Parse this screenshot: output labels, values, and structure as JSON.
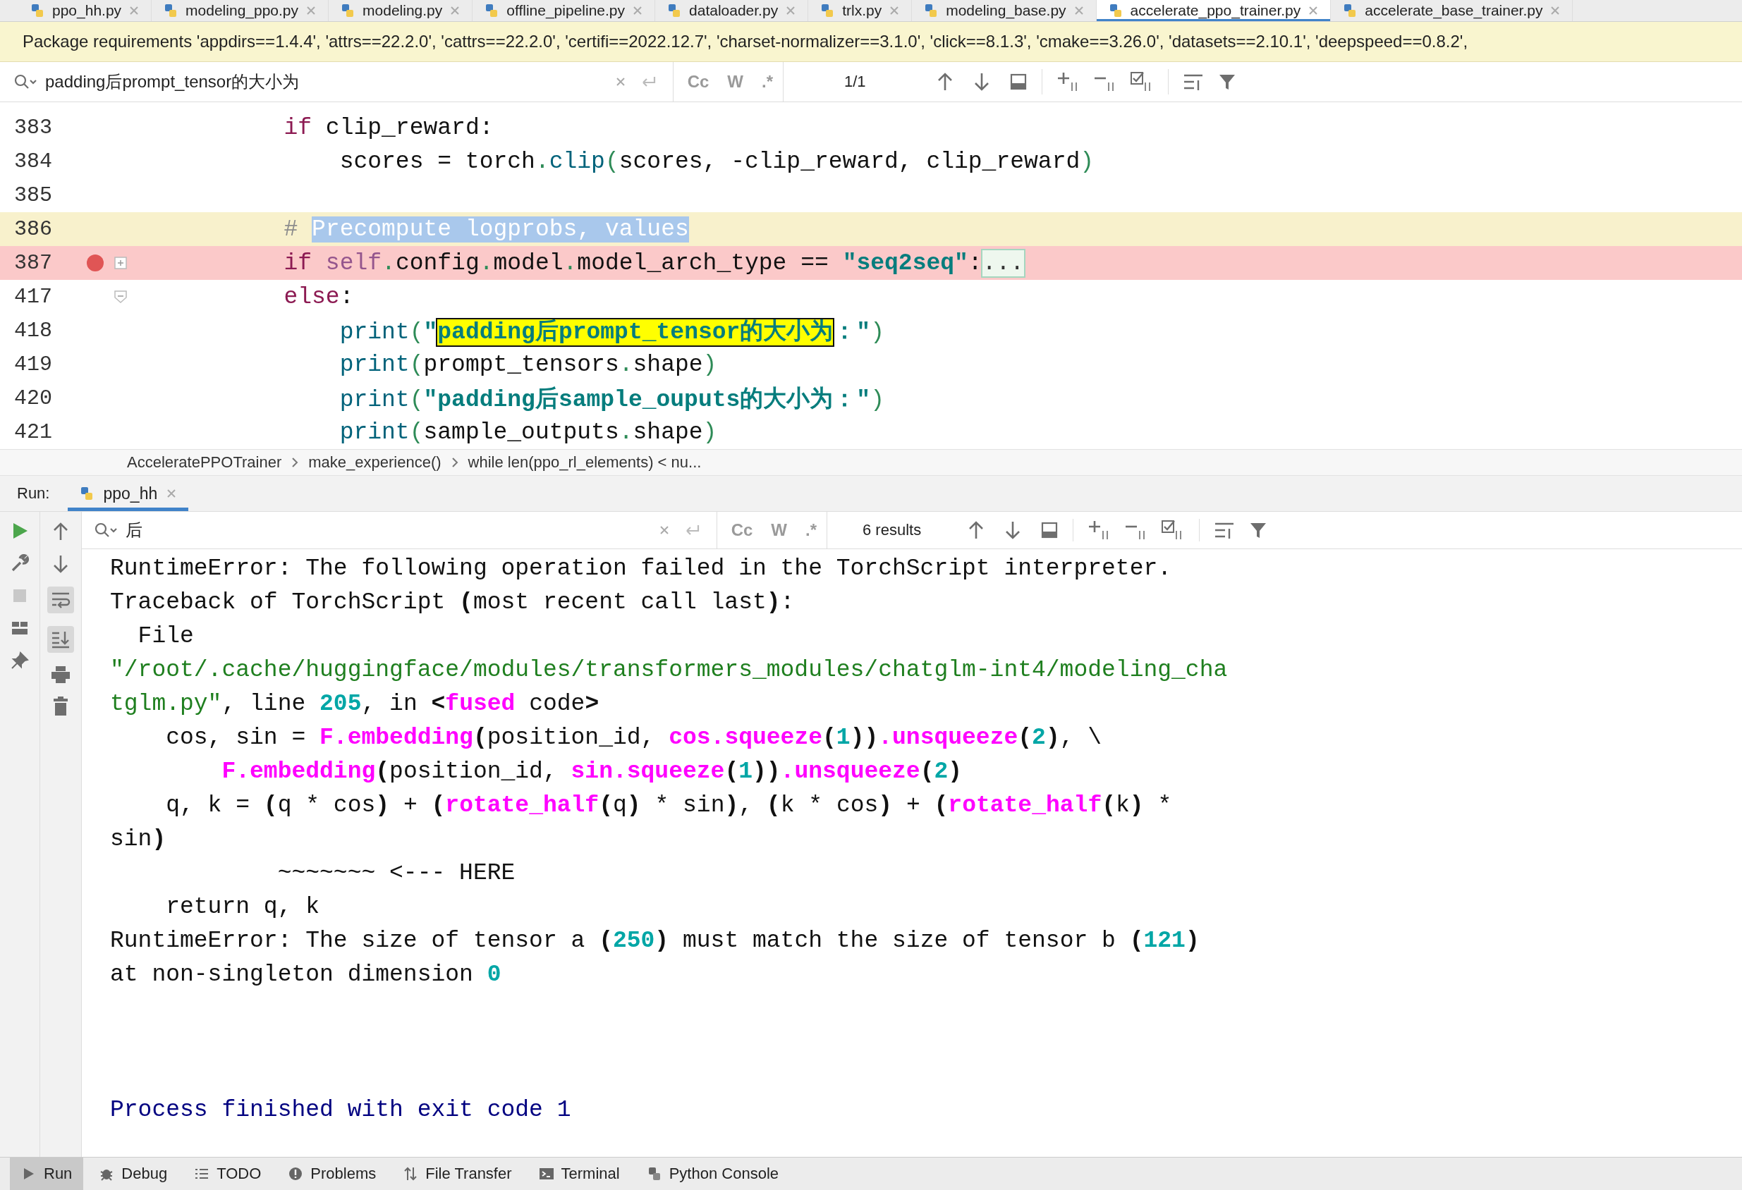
{
  "editor_tabs": [
    {
      "label": "ppo_hh.py",
      "selected": false
    },
    {
      "label": "modeling_ppo.py",
      "selected": false
    },
    {
      "label": "modeling.py",
      "selected": false
    },
    {
      "label": "offline_pipeline.py",
      "selected": false
    },
    {
      "label": "dataloader.py",
      "selected": false
    },
    {
      "label": "trlx.py",
      "selected": false
    },
    {
      "label": "modeling_base.py",
      "selected": false
    },
    {
      "label": "accelerate_ppo_trainer.py",
      "selected": true
    },
    {
      "label": "accelerate_base_trainer.py",
      "selected": false
    }
  ],
  "warning_bar": {
    "text": "Package requirements 'appdirs==1.4.4', 'attrs==22.2.0', 'cattrs==22.2.0', 'certifi==2022.12.7', 'charset-normalizer==3.1.0', 'click==8.1.3', 'cmake==3.26.0', 'datasets==2.10.1', 'deepspeed==0.8.2',"
  },
  "editor_find": {
    "value": "padding后prompt_tensor的大小为",
    "options": [
      "Cc",
      "W",
      ".*"
    ],
    "count": "1/1"
  },
  "code_lines": [
    {
      "number": "383",
      "kind": "plain",
      "breakpoint": false,
      "segments": [
        {
          "kind": "kw",
          "text": "        if"
        },
        {
          "kind": "plain",
          "text": " clip_reward:"
        }
      ]
    },
    {
      "number": "384",
      "kind": "plain",
      "breakpoint": false,
      "segments": [
        {
          "kind": "plain",
          "text": "            scores = torch"
        },
        {
          "kind": "dot",
          "text": "."
        },
        {
          "kind": "call",
          "text": "clip"
        },
        {
          "kind": "paren",
          "text": "("
        },
        {
          "kind": "plain",
          "text": "scores, -clip_reward, clip_reward"
        },
        {
          "kind": "paren",
          "text": ")"
        }
      ]
    },
    {
      "number": "385",
      "kind": "plain",
      "breakpoint": false
    },
    {
      "number": "386",
      "kind": "current",
      "breakpoint": false,
      "segments": [
        {
          "kind": "comment",
          "text": "        # "
        },
        {
          "kind": "selected",
          "text": "Precompute logprobs, values"
        }
      ]
    },
    {
      "number": "387",
      "kind": "breakpoint",
      "breakpoint": true,
      "expanded": false,
      "segments": [
        {
          "kind": "kw",
          "text": "        if "
        },
        {
          "kind": "self",
          "text": "self"
        },
        {
          "kind": "dot",
          "text": "."
        },
        {
          "kind": "plain",
          "text": "config"
        },
        {
          "kind": "dot",
          "text": "."
        },
        {
          "kind": "plain",
          "text": "model"
        },
        {
          "kind": "dot",
          "text": "."
        },
        {
          "kind": "plain",
          "text": "model_arch_type == "
        },
        {
          "kind": "str",
          "text": "\"seq2seq\""
        },
        {
          "kind": "plain",
          "text": ":"
        },
        {
          "kind": "folded",
          "text": "..."
        }
      ]
    },
    {
      "number": "417",
      "kind": "plain",
      "breakpoint": false,
      "expanded": true,
      "segments": [
        {
          "kind": "kw",
          "text": "        else"
        },
        {
          "kind": "plain",
          "text": ":"
        }
      ]
    },
    {
      "number": "418",
      "kind": "plain",
      "breakpoint": false,
      "segments": [
        {
          "kind": "call",
          "text": "            print"
        },
        {
          "kind": "paren",
          "text": "("
        },
        {
          "kind": "str",
          "text": "\""
        },
        {
          "kind": "match",
          "text": "padding后prompt_tensor的大小为"
        },
        {
          "kind": "str",
          "text": "：\""
        },
        {
          "kind": "paren",
          "text": ")"
        }
      ]
    },
    {
      "number": "419",
      "kind": "plain",
      "breakpoint": false,
      "segments": [
        {
          "kind": "call",
          "text": "            print"
        },
        {
          "kind": "paren",
          "text": "("
        },
        {
          "kind": "plain",
          "text": "prompt_tensors"
        },
        {
          "kind": "dot",
          "text": "."
        },
        {
          "kind": "plain",
          "text": "shape"
        },
        {
          "kind": "paren",
          "text": ")"
        }
      ]
    },
    {
      "number": "420",
      "kind": "plain",
      "breakpoint": false,
      "segments": [
        {
          "kind": "call",
          "text": "            print"
        },
        {
          "kind": "paren",
          "text": "("
        },
        {
          "kind": "str",
          "text": "\"padding后sample_ouputs的大小为：\""
        },
        {
          "kind": "paren",
          "text": ")"
        }
      ]
    },
    {
      "number": "421",
      "kind": "plain",
      "breakpoint": false,
      "segments": [
        {
          "kind": "call",
          "text": "            print"
        },
        {
          "kind": "paren",
          "text": "("
        },
        {
          "kind": "plain",
          "text": "sample_outputs"
        },
        {
          "kind": "dot",
          "text": "."
        },
        {
          "kind": "plain",
          "text": "shape"
        },
        {
          "kind": "paren",
          "text": ")"
        }
      ]
    }
  ],
  "breadcrumb": [
    "AcceleratePPOTrainer",
    "make_experience()",
    "while len(ppo_rl_elements) < nu..."
  ],
  "run_panel": {
    "label": "Run:",
    "tab": {
      "label": "ppo_hh",
      "selected": true
    }
  },
  "console_find": {
    "value": "后",
    "options": [
      "Cc",
      "W",
      ".*"
    ],
    "count": "6 results"
  },
  "console_lines": [
    {
      "kind": "output",
      "segments": [
        {
          "kind": "plain",
          "text": "RuntimeError: The following operation failed in the TorchScript interpreter."
        }
      ]
    },
    {
      "kind": "output",
      "segments": [
        {
          "kind": "plain",
          "text": "Traceback of TorchScript "
        },
        {
          "kind": "bold",
          "text": "("
        },
        {
          "kind": "plain",
          "text": "most recent call last"
        },
        {
          "kind": "bold",
          "text": ")"
        },
        {
          "kind": "plain",
          "text": ":"
        }
      ]
    },
    {
      "kind": "output",
      "segments": [
        {
          "kind": "plain",
          "text": "  File"
        }
      ]
    },
    {
      "kind": "output",
      "segments": [
        {
          "kind": "path",
          "text": "\"/root/.cache/huggingface/modules/transformers_modules/chatglm-int4/modeling_cha"
        }
      ]
    },
    {
      "kind": "output",
      "segments": [
        {
          "kind": "path",
          "text": "tglm.py\""
        },
        {
          "kind": "plain",
          "text": ", line "
        },
        {
          "kind": "num",
          "text": "205"
        },
        {
          "kind": "plain",
          "text": ", in "
        },
        {
          "kind": "bold",
          "text": "<"
        },
        {
          "kind": "mag",
          "text": "fused"
        },
        {
          "kind": "plain",
          "text": " code"
        },
        {
          "kind": "bold",
          "text": ">"
        }
      ]
    },
    {
      "kind": "output",
      "segments": [
        {
          "kind": "plain",
          "text": "    cos, sin = "
        },
        {
          "kind": "mag",
          "text": "F.embedding"
        },
        {
          "kind": "bold",
          "text": "("
        },
        {
          "kind": "plain",
          "text": "position_id, "
        },
        {
          "kind": "mag",
          "text": "cos.squeeze"
        },
        {
          "kind": "bold",
          "text": "("
        },
        {
          "kind": "num",
          "text": "1"
        },
        {
          "kind": "bold",
          "text": "))"
        },
        {
          "kind": "mag",
          "text": ".unsqueeze"
        },
        {
          "kind": "bold",
          "text": "("
        },
        {
          "kind": "num",
          "text": "2"
        },
        {
          "kind": "bold",
          "text": ")"
        },
        {
          "kind": "plain",
          "text": ", \\"
        }
      ]
    },
    {
      "kind": "output",
      "segments": [
        {
          "kind": "mag",
          "text": "        F.embedding"
        },
        {
          "kind": "bold",
          "text": "("
        },
        {
          "kind": "plain",
          "text": "position_id, "
        },
        {
          "kind": "mag",
          "text": "sin.squeeze"
        },
        {
          "kind": "bold",
          "text": "("
        },
        {
          "kind": "num",
          "text": "1"
        },
        {
          "kind": "bold",
          "text": "))"
        },
        {
          "kind": "mag",
          "text": ".unsqueeze"
        },
        {
          "kind": "bold",
          "text": "("
        },
        {
          "kind": "num",
          "text": "2"
        },
        {
          "kind": "bold",
          "text": ")"
        }
      ]
    },
    {
      "kind": "output",
      "segments": [
        {
          "kind": "plain",
          "text": "    q, k = "
        },
        {
          "kind": "bold",
          "text": "("
        },
        {
          "kind": "plain",
          "text": "q * cos"
        },
        {
          "kind": "bold",
          "text": ")"
        },
        {
          "kind": "plain",
          "text": " + "
        },
        {
          "kind": "bold",
          "text": "("
        },
        {
          "kind": "mag",
          "text": "rotate_half"
        },
        {
          "kind": "bold",
          "text": "("
        },
        {
          "kind": "plain",
          "text": "q"
        },
        {
          "kind": "bold",
          "text": ")"
        },
        {
          "kind": "plain",
          "text": " * sin"
        },
        {
          "kind": "bold",
          "text": ")"
        },
        {
          "kind": "plain",
          "text": ", "
        },
        {
          "kind": "bold",
          "text": "("
        },
        {
          "kind": "plain",
          "text": "k * cos"
        },
        {
          "kind": "bold",
          "text": ")"
        },
        {
          "kind": "plain",
          "text": " + "
        },
        {
          "kind": "bold",
          "text": "("
        },
        {
          "kind": "mag",
          "text": "rotate_half"
        },
        {
          "kind": "bold",
          "text": "("
        },
        {
          "kind": "plain",
          "text": "k"
        },
        {
          "kind": "bold",
          "text": ")"
        },
        {
          "kind": "plain",
          "text": " *"
        }
      ]
    },
    {
      "kind": "output",
      "segments": [
        {
          "kind": "plain",
          "text": "sin"
        },
        {
          "kind": "bold",
          "text": ")"
        }
      ]
    },
    {
      "kind": "output",
      "segments": [
        {
          "kind": "plain",
          "text": "            ~~~~~~~ <--- HERE"
        }
      ]
    },
    {
      "kind": "output",
      "segments": [
        {
          "kind": "plain",
          "text": "    return q, k"
        }
      ]
    },
    {
      "kind": "output",
      "segments": [
        {
          "kind": "plain",
          "text": "RuntimeError: The size of tensor a "
        },
        {
          "kind": "bold",
          "text": "("
        },
        {
          "kind": "num",
          "text": "250"
        },
        {
          "kind": "bold",
          "text": ")"
        },
        {
          "kind": "plain",
          "text": " must match the size of tensor b "
        },
        {
          "kind": "bold",
          "text": "("
        },
        {
          "kind": "num",
          "text": "121"
        },
        {
          "kind": "bold",
          "text": ")"
        }
      ]
    },
    {
      "kind": "output",
      "segments": [
        {
          "kind": "plain",
          "text": "at non-singleton dimension "
        },
        {
          "kind": "num",
          "text": "0"
        }
      ]
    },
    {
      "kind": "exit",
      "segments": [
        {
          "kind": "plain",
          "text": "Process finished with exit code 1"
        }
      ]
    }
  ],
  "tool_windows": [
    {
      "label": "Run",
      "selected": true
    },
    {
      "label": "Debug",
      "selected": false
    },
    {
      "label": "TODO",
      "selected": false
    },
    {
      "label": "Problems",
      "selected": false
    },
    {
      "label": "File Transfer",
      "selected": false
    },
    {
      "label": "Terminal",
      "selected": false
    },
    {
      "label": "Python Console",
      "selected": false
    }
  ]
}
